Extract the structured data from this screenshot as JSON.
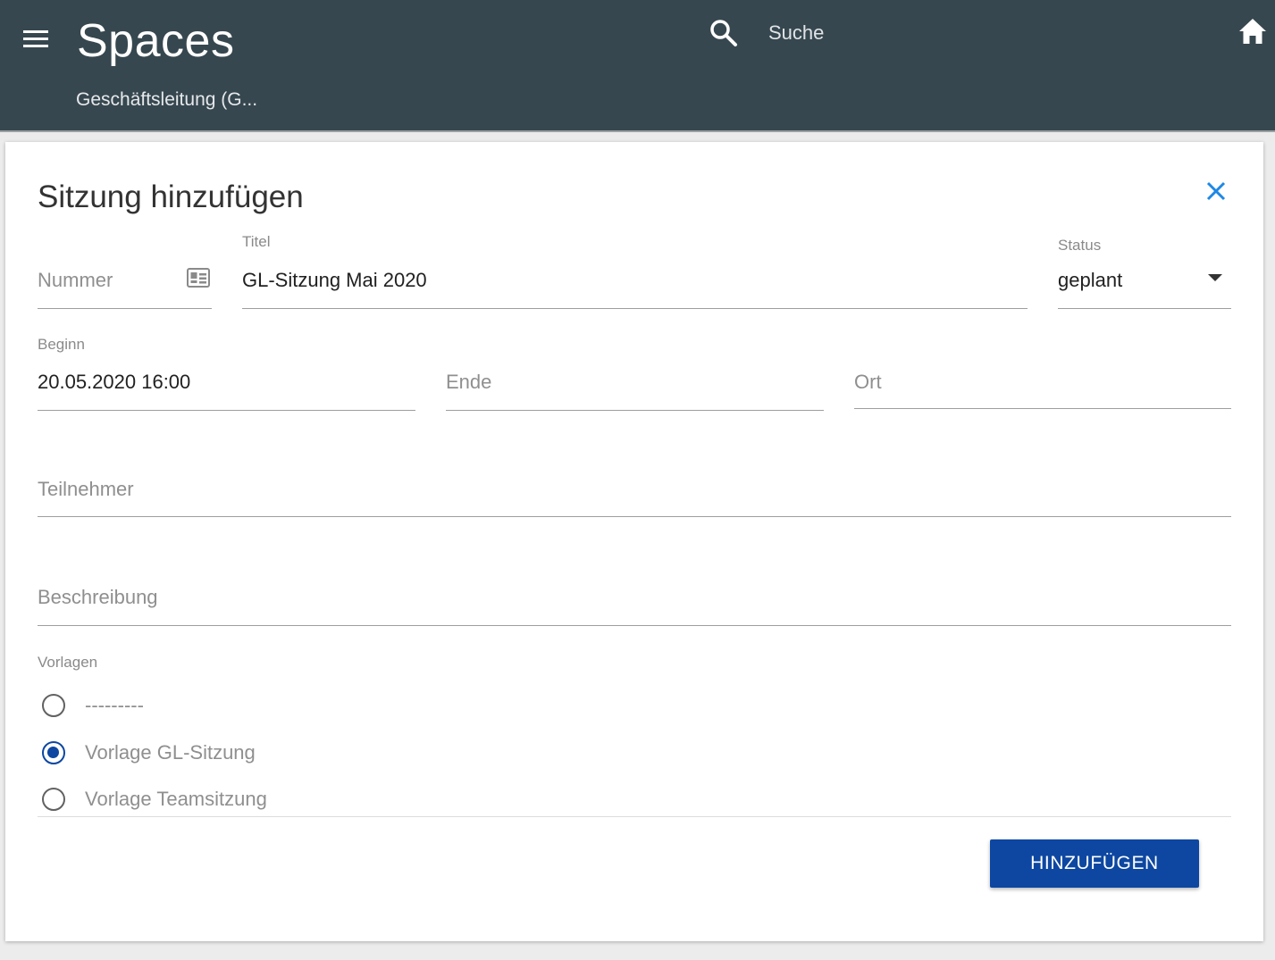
{
  "header": {
    "app_title": "Spaces",
    "space_name": "Geschäftsleitung (G...",
    "search_placeholder": "Suche",
    "icons": [
      "menu-icon",
      "search-icon",
      "home-icon"
    ]
  },
  "dialog": {
    "title": "Sitzung hinzufügen",
    "fields": {
      "nummer": {
        "placeholder": "Nummer",
        "icon": "id-card-icon"
      },
      "titel": {
        "label": "Titel",
        "value": "GL-Sitzung Mai 2020"
      },
      "status": {
        "label": "Status",
        "value": "geplant"
      },
      "beginn": {
        "label": "Beginn",
        "value": "20.05.2020 16:00"
      },
      "ende": {
        "placeholder": "Ende"
      },
      "ort": {
        "placeholder": "Ort"
      },
      "teilnehmer": {
        "placeholder": "Teilnehmer"
      },
      "beschreibung": {
        "placeholder": "Beschreibung"
      }
    },
    "vorlagen": {
      "label": "Vorlagen",
      "options": [
        {
          "label": "---------",
          "checked": false
        },
        {
          "label": "Vorlage GL-Sitzung",
          "checked": true
        },
        {
          "label": "Vorlage Teamsitzung",
          "checked": false
        }
      ]
    },
    "submit_label": "HINZUFÜGEN"
  },
  "colors": {
    "header_bg": "#37474f",
    "primary": "#0d47a1",
    "close_icon": "#1e88e5"
  }
}
